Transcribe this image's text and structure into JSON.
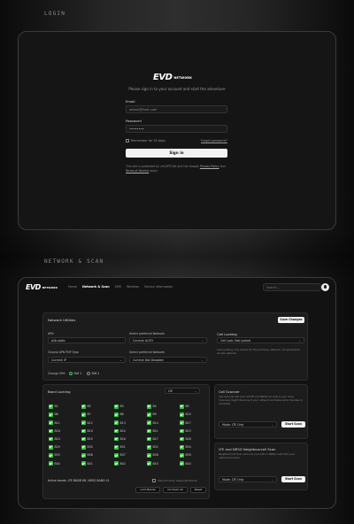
{
  "sections": {
    "login_label": "LOGIN",
    "network_label": "NETWORK & SCAN"
  },
  "brand": {
    "mark": "EVD",
    "sub": "NETWORK"
  },
  "login": {
    "subtitle": "Please sign in to your account and start the adventure",
    "email_label": "Email",
    "email_value": "admin@host.com",
    "password_label": "Password",
    "password_value": "••••••••",
    "remember_label": "Remember for 30 days",
    "forgot_label": "Forgot password?",
    "signin_label": "Sign in",
    "terms_text": "This site is protected by reCAPTCHA and the Google",
    "privacy_label": "Privacy Policy",
    "and_text": "and",
    "terms_label": "Terms of Service",
    "apply_text": "apply."
  },
  "nav": {
    "items": [
      "Home",
      "Network & Scan",
      "SMS",
      "Wireless",
      "Device Information"
    ],
    "active_index": 1,
    "search_placeholder": "Search..."
  },
  "utilities": {
    "title": "Network Utilities",
    "save_label": "Save Changes",
    "apn_label": "APN",
    "apn_value": "b2b.static",
    "pref_network_label": "Select preferred Network",
    "pref_network_value": "Current: AUTO",
    "pdp_label": "Choose APN PDP Type",
    "pdp_value": "Current: IP",
    "pref_network2_label": "Select preferred Network",
    "pref_network2_value": "Current: Not Disabled",
    "sim_label": "Change SIM:",
    "sim1": "SIM 1",
    "sim2": "SIM 2"
  },
  "cell_locking": {
    "title": "Cell Locking",
    "value": "Cell Lock: Not Locked",
    "help": "Cell Locking only works for the primary network not persistent across reboots"
  },
  "band_locking": {
    "title": "Band Locking",
    "mode": "LTE",
    "bands": [
      "B1",
      "B2",
      "B3",
      "B4",
      "B5",
      "B6",
      "B7",
      "B8",
      "B9",
      "B10",
      "B11",
      "B12",
      "B13",
      "B14",
      "B17",
      "B18",
      "B19",
      "B20",
      "B21",
      "B23",
      "B24",
      "B25",
      "B26",
      "B27",
      "B28",
      "B29",
      "B30",
      "B31",
      "B32",
      "B34",
      "B35",
      "B36",
      "B37",
      "B38",
      "B39",
      "B40",
      "B41",
      "B42",
      "B43",
      "B44"
    ],
    "show_supported_label": "Show Provider Supported Bands",
    "active_text": "Active bands: LTE BAND 66, NRSG BAND 41",
    "lock_label": "Lock Bands",
    "uncheck_label": "Uncheck All",
    "reset_label": "Reset"
  },
  "cell_scanner": {
    "title": "Cell Scanner",
    "help": "Cell Scanner will scan all LTE and NR5G SA cells in your area. Scanning might disconnect your network and take some minutes to complete.",
    "mode": "Mode: LTE Only",
    "start_label": "Start Scan"
  },
  "neighbour_scan": {
    "title": "LTE and NR5G Neighbourcell Scan",
    "help": "Neighbourcell Scan will only scan LTE or NR5G cells from your network provider.",
    "mode": "Mode: LTE Only",
    "start_label": "Start Scan"
  },
  "colors": {
    "accent": "#2fc23f",
    "primary_button": "#f2f2f2",
    "panel": "#1c1c1c"
  }
}
